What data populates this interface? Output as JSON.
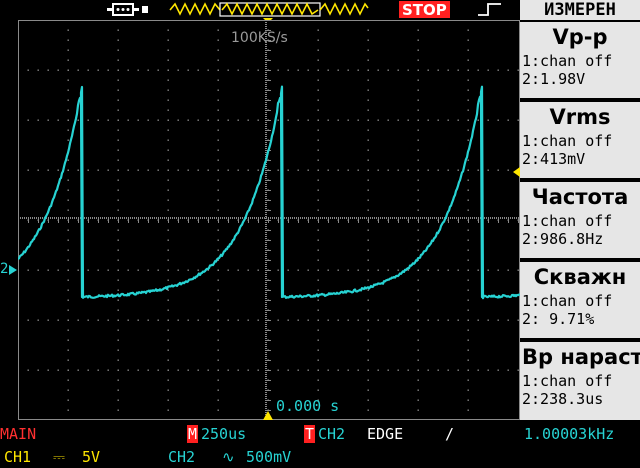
{
  "top": {
    "sample_rate": "100KS/s",
    "run_state": "STOP"
  },
  "measure": {
    "title": "ИЗМЕРЕН",
    "items": [
      {
        "name": "Vp-p",
        "ch1": "1:chan off",
        "ch2": "2:1.98V"
      },
      {
        "name": "Vrms",
        "ch1": "1:chan off",
        "ch2": "2:413mV"
      },
      {
        "name": "Частота",
        "ch1": "1:chan off",
        "ch2": "2:986.8Hz"
      },
      {
        "name": "Скважн",
        "ch1": "1:chan off",
        "ch2": "2: 9.71%"
      },
      {
        "name": "Вр нараст",
        "ch1": "1:chan off",
        "ch2": "2:238.3us"
      }
    ]
  },
  "screen": {
    "trigger_position": "0.000 s",
    "ch2_marker": "2"
  },
  "status": {
    "main": "MAIN",
    "timebase_tag": "M",
    "timebase": "250us",
    "trig_tag": "T",
    "trig_source": "CH2",
    "trig_type": "EDGE",
    "trig_slope": "/",
    "trig_freq": "1.00003kHz",
    "ch1": "CH1",
    "ch1_coupling": "⎓",
    "ch1_scale": "5V",
    "ch2": "CH2",
    "ch2_coupling": "∿",
    "ch2_scale": "500mV"
  },
  "colors": {
    "trace": "#27d3d3",
    "accent": "#ffe600",
    "stop": "#ff2020",
    "grid": "#8a8a8a"
  }
}
